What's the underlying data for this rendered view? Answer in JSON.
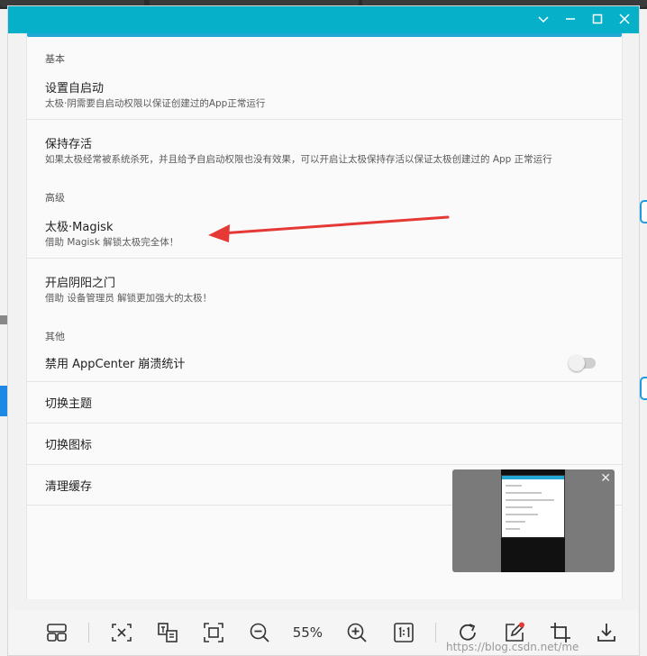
{
  "viewer": {
    "window_controls": [
      "chevron-down",
      "minimize",
      "maximize",
      "close"
    ],
    "accent_color": "#07b0c9",
    "zoom_level": "55%"
  },
  "settings": {
    "sections": [
      {
        "header": "基本"
      },
      {
        "header": "高级"
      },
      {
        "header": "其他"
      }
    ],
    "items": [
      {
        "title": "设置自启动",
        "subtitle": "太极·阴需要自启动权限以保证创建过的App正常运行"
      },
      {
        "title": "保持存活",
        "subtitle": "如果太极经常被系统杀死，并且给予自启动权限也没有效果，可以开启让太极保持存活以保证太极创建过的 App 正常运行"
      },
      {
        "title": "太极·Magisk",
        "subtitle": "借助 Magisk 解锁太极完全体！"
      },
      {
        "title": "开启阴阳之门",
        "subtitle": "借助 设备管理员 解锁更加强大的太极！"
      },
      {
        "title": "禁用 AppCenter 崩溃统计",
        "toggle_on": false
      },
      {
        "title": "切换主题"
      },
      {
        "title": "切换图标"
      },
      {
        "title": "清理缓存"
      }
    ]
  },
  "annotation": {
    "arrow_color": "#e53935"
  },
  "watermark": "https://blog.csdn.net/me"
}
